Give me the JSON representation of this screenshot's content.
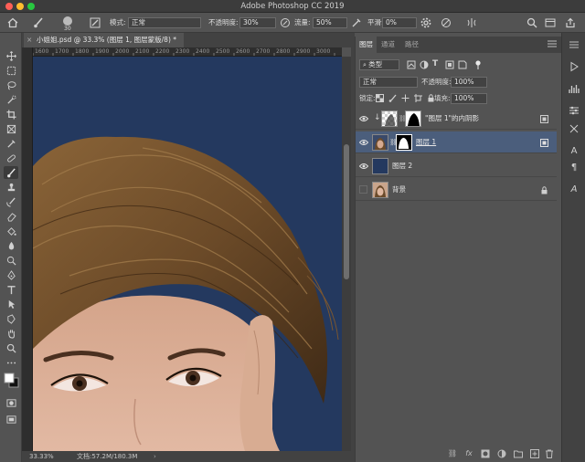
{
  "app": {
    "title": "Adobe Photoshop CC 2019"
  },
  "options_bar": {
    "brush_size": "30",
    "mode_label": "模式:",
    "mode_value": "正常",
    "opacity_label": "不透明度:",
    "opacity_value": "30%",
    "flow_label": "流量:",
    "flow_value": "50%",
    "smoothing_label": "平滑:",
    "smoothing_value": "0%"
  },
  "document": {
    "tab_title": "小姐姐.psd @ 33.3% (图层 1, 图层蒙版/8) *",
    "zoom": "33.33%",
    "doc_info": "文档:57.2M/180.3M",
    "ruler_labels": [
      "1600",
      "1700",
      "1800",
      "1900",
      "2000",
      "2100",
      "2200",
      "2300",
      "2400",
      "2500",
      "2600",
      "2700",
      "2800",
      "2900",
      "3000"
    ],
    "canvas_bg": "#24395f"
  },
  "layers_panel": {
    "tabs": [
      "图层",
      "通道",
      "路径"
    ],
    "filter_label": "类型",
    "blend_mode": "正常",
    "opacity_label": "不透明度:",
    "opacity_value": "100%",
    "lock_label": "锁定:",
    "fill_label": "填充:",
    "fill_value": "100%",
    "layers": [
      {
        "name": "\"图层 1\"的内阴影",
        "visible": true,
        "selected": false,
        "clipped": true
      },
      {
        "name": "图层 1",
        "visible": true,
        "selected": true
      },
      {
        "name": "图层 2",
        "visible": true,
        "selected": false
      },
      {
        "name": "背景",
        "visible": false,
        "selected": false,
        "locked": true
      }
    ],
    "footer": [
      "link-icon",
      "fx",
      "mask-icon",
      "adjustment-icon",
      "folder-icon",
      "new-layer-icon",
      "trash-icon"
    ]
  },
  "colors": {
    "accent_selected": "#4b5e7c",
    "canvas": "#24395f"
  }
}
